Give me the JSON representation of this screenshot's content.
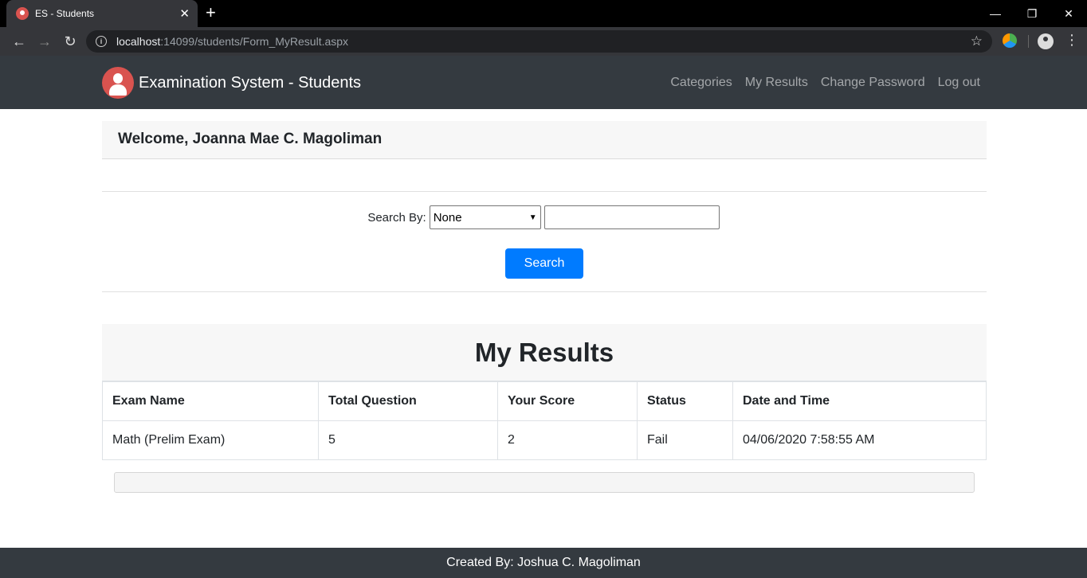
{
  "browser": {
    "tab_title": "ES - Students",
    "url_host": "localhost",
    "url_rest": ":14099/students/Form_MyResult.aspx"
  },
  "navbar": {
    "brand": "Examination System - Students",
    "links": [
      "Categories",
      "My Results",
      "Change Password",
      "Log out"
    ]
  },
  "welcome": "Welcome, Joanna Mae C. Magoliman",
  "search": {
    "label": "Search By:",
    "selected": "None",
    "button": "Search",
    "input_value": ""
  },
  "results": {
    "title": "My Results",
    "columns": [
      "Exam Name",
      "Total Question",
      "Your Score",
      "Status",
      "Date and Time"
    ],
    "rows": [
      [
        "Math (Prelim Exam)",
        "5",
        "2",
        "Fail",
        "04/06/2020 7:58:55 AM"
      ]
    ]
  },
  "footer": "Created By: Joshua C. Magoliman",
  "colors": {
    "navbar": "#343a40",
    "primary": "#007bff",
    "logo": "#d9534f"
  }
}
